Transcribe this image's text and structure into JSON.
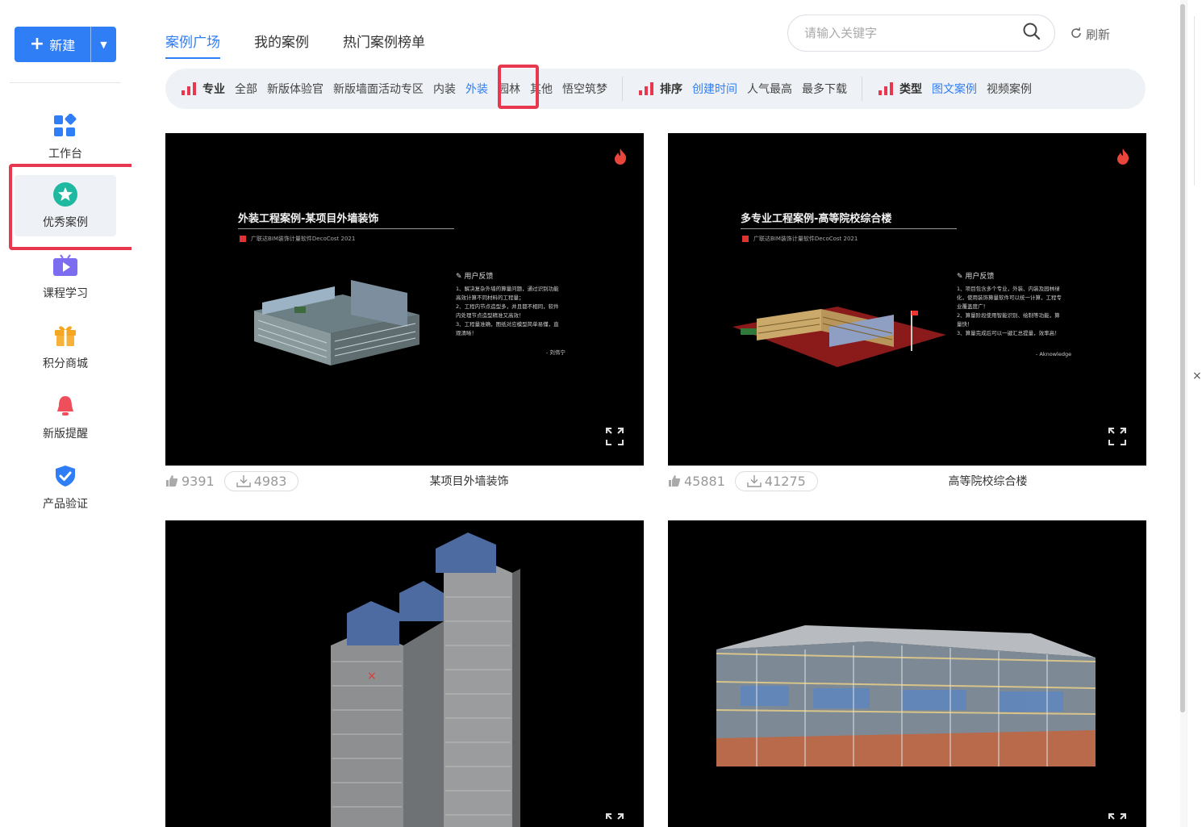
{
  "sidebar": {
    "new_label": "新建",
    "items": [
      {
        "label": "工作台",
        "icon": "dashboard-icon"
      },
      {
        "label": "优秀案例",
        "icon": "star-badge-icon"
      },
      {
        "label": "课程学习",
        "icon": "tv-play-icon"
      },
      {
        "label": "积分商城",
        "icon": "gift-icon"
      },
      {
        "label": "新版提醒",
        "icon": "bell-icon"
      },
      {
        "label": "产品验证",
        "icon": "shield-check-icon"
      }
    ]
  },
  "tabs": [
    "案例广场",
    "我的案例",
    "热门案例榜单"
  ],
  "search": {
    "placeholder": "请输入关键字"
  },
  "refresh_label": "刷新",
  "filters": {
    "specialty": {
      "title": "专业",
      "options": [
        "全部",
        "新版体验官",
        "新版墙面活动专区",
        "内装",
        "外装",
        "园林",
        "其他",
        "悟空筑梦"
      ],
      "selected": "外装"
    },
    "sort": {
      "title": "排序",
      "options": [
        "创建时间",
        "人气最高",
        "最多下载"
      ],
      "selected": "创建时间"
    },
    "type": {
      "title": "类型",
      "options": [
        "图文案例",
        "视频案例"
      ],
      "selected": "图文案例"
    }
  },
  "cards": [
    {
      "slide_title": "外装工程案例-某项目外墙装饰",
      "slide_subtitle": "广联达BIM装饰计量软件DecoCost 2021",
      "feedback_title": "用户反馈",
      "feedback_text": "1、解决复杂外墙的算量问题，通过识别功能\n高效计算不同材料的工程量；\n2、工程内节点造型多，并且都不相同，软件\n内处理节点造型精准又高效！\n3、工程量准确，图纸对应模型简单易懂，直\n观清晰！",
      "feedback_author": "- 刘伟宁",
      "likes": "9391",
      "downloads": "4983",
      "name": "某项目外墙装饰"
    },
    {
      "slide_title": "多专业工程案例-高等院校综合楼",
      "slide_subtitle": "广联达BIM装饰计量软件DecoCost 2021",
      "feedback_title": "用户反馈",
      "feedback_text": "1、项目包含多个专业，外装、内装及园林绿\n化，使用装饰算量软件可以统一计算，工程专\n业覆盖度广！\n2、算量阶段使用智能识别、绘制等功能，算\n量快！\n3、算量完成后可以一键汇总提量，效率高！",
      "feedback_author": "- Aknowledge",
      "likes": "45881",
      "downloads": "41275",
      "name": "高等院校综合楼"
    }
  ],
  "colors": {
    "accent": "#2f7ef5",
    "highlight": "#e8384f",
    "fire": "#e8453c"
  }
}
